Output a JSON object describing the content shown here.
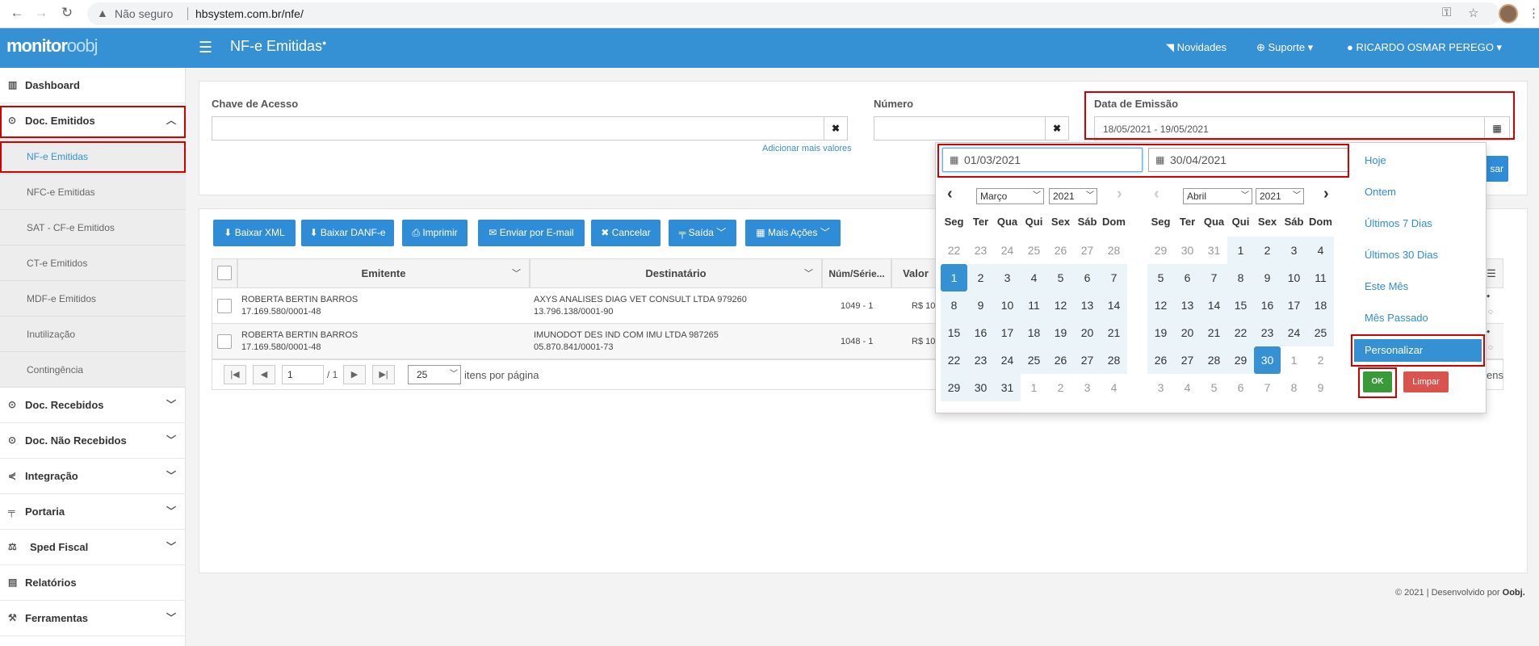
{
  "browser": {
    "warning": "Não seguro",
    "url": "hbsystem.com.br/nfe/"
  },
  "header": {
    "logo_main": "monitor",
    "logo_sub": "oobj",
    "title": "NF-e Emitidas",
    "title_badge": "●",
    "nav": [
      {
        "label": "Novidades",
        "icon": "rss-icon"
      },
      {
        "label": "Suporte ▾",
        "icon": "globe-icon"
      },
      {
        "label": "RICARDO OSMAR PEREGO ▾",
        "icon": "user-icon"
      }
    ]
  },
  "sidebar": {
    "items": [
      {
        "label": "Dashboard",
        "icon": "chart-icon"
      },
      {
        "label": "Doc. Emitidos",
        "icon": "circle-icon",
        "expanded": true
      },
      {
        "label": "Doc. Recebidos",
        "icon": "circle-icon"
      },
      {
        "label": "Doc. Não Recebidos",
        "icon": "circle-icon"
      },
      {
        "label": "Integração",
        "icon": "share-icon"
      },
      {
        "label": "Portaria",
        "icon": "sign-icon"
      },
      {
        "label": "Sped Fiscal",
        "icon": "scale-icon"
      },
      {
        "label": "Relatórios",
        "icon": "file-icon"
      },
      {
        "label": "Ferramentas",
        "icon": "wrench-icon"
      }
    ],
    "subitems": [
      {
        "label": "NF-e Emitidas",
        "active": true
      },
      {
        "label": "NFC-e Emitidas"
      },
      {
        "label": "SAT - CF-e Emitidos"
      },
      {
        "label": "CT-e Emitidos"
      },
      {
        "label": "MDF-e Emitidos"
      },
      {
        "label": "Inutilização"
      },
      {
        "label": "Contingência"
      }
    ]
  },
  "filters": {
    "chave_label": "Chave de Acesso",
    "chave_value": "",
    "add_more": "Adicionar mais valores",
    "numero_label": "Número",
    "numero_value": "",
    "data_label": "Data de Emissão",
    "data_value": "18/05/2021 - 19/05/2021",
    "search_button_partial": "sar"
  },
  "actions": [
    "Baixar XML",
    "Baixar DANF-e",
    "Imprimir",
    "Enviar por E-mail",
    "Cancelar",
    "Saída",
    "Mais Ações"
  ],
  "table": {
    "headers": [
      "Emitente",
      "Destinatário",
      "Núm/Série...",
      "Valor"
    ],
    "rows": [
      {
        "emitente": "ROBERTA BERTIN BARROS",
        "emitente_doc": "17.169.580/0001-48",
        "destinatario": "AXYS ANALISES DIAG VET CONSULT LTDA 979260",
        "destinatario_doc": "13.796.138/0001-90",
        "numserie": "1049 - 1",
        "valor": "R$ 10,"
      },
      {
        "emitente": "ROBERTA BERTIN BARROS",
        "emitente_doc": "17.169.580/0001-48",
        "destinatario": "IMUNODOT DES IND COM IMU LTDA 987265",
        "destinatario_doc": "05.870.841/0001-73",
        "numserie": "1048 - 1",
        "valor": "R$ 10,"
      }
    ],
    "pager": {
      "page": "1",
      "of": "/ 1",
      "per_page": "25",
      "per_page_label": "itens por página",
      "right_partial": "ens"
    }
  },
  "datepicker": {
    "start": "01/03/2021",
    "end": "30/04/2021",
    "left_month": "Março",
    "left_year": "2021",
    "right_month": "Abril",
    "right_year": "2021",
    "weekdays": [
      "Seg",
      "Ter",
      "Qua",
      "Qui",
      "Sex",
      "Sáb",
      "Dom"
    ],
    "left_days": [
      [
        22,
        23,
        24,
        25,
        26,
        27,
        28
      ],
      [
        1,
        2,
        3,
        4,
        5,
        6,
        7
      ],
      [
        8,
        9,
        10,
        11,
        12,
        13,
        14
      ],
      [
        15,
        16,
        17,
        18,
        19,
        20,
        21
      ],
      [
        22,
        23,
        24,
        25,
        26,
        27,
        28
      ],
      [
        29,
        30,
        31,
        1,
        2,
        3,
        4
      ]
    ],
    "right_days": [
      [
        29,
        30,
        31,
        1,
        2,
        3,
        4
      ],
      [
        5,
        6,
        7,
        8,
        9,
        10,
        11
      ],
      [
        12,
        13,
        14,
        15,
        16,
        17,
        18
      ],
      [
        19,
        20,
        21,
        22,
        23,
        24,
        25
      ],
      [
        26,
        27,
        28,
        29,
        30,
        1,
        2
      ],
      [
        3,
        4,
        5,
        6,
        7,
        8,
        9
      ]
    ],
    "ranges": [
      "Hoje",
      "Ontem",
      "Últimos 7 Dias",
      "Últimos 30 Dias",
      "Este Mês",
      "Mês Passado",
      "Personalizar"
    ],
    "ok": "OK",
    "clear": "Limpar"
  },
  "footer": {
    "text": "© 2021 | Desenvolvido por ",
    "brand": "Oobj."
  }
}
